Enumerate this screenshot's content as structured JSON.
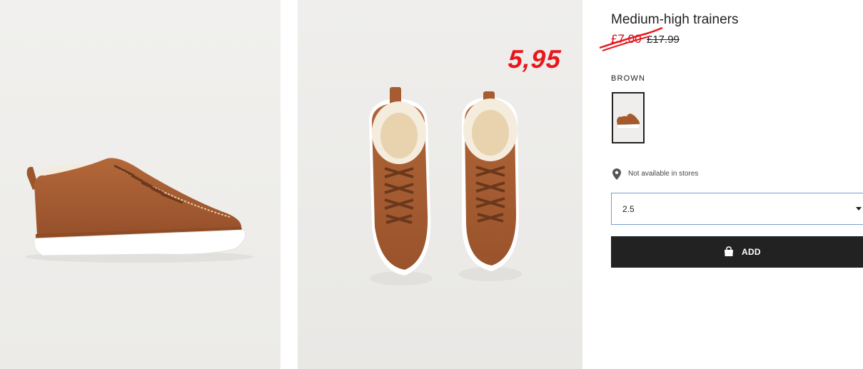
{
  "sticker": {
    "price": "5,95"
  },
  "product": {
    "title": "Medium-high trainers",
    "sale_price": "£7.00",
    "regular_price": "£17.99"
  },
  "color": {
    "label": "BROWN",
    "swatch_icon": "shoe-thumbnail",
    "value_hex": "#a45a2a"
  },
  "store": {
    "icon": "location-pin-icon",
    "text": "Not available in stores"
  },
  "size_select": {
    "value": "2.5"
  },
  "add_button": {
    "icon": "shopping-bag-icon",
    "label": "ADD"
  },
  "colors": {
    "sticker_red": "#e8171c",
    "sale_red": "#d0021b",
    "button_black": "#222222",
    "select_border": "#7a9cd0",
    "leather_brown": "#a45a2a"
  }
}
